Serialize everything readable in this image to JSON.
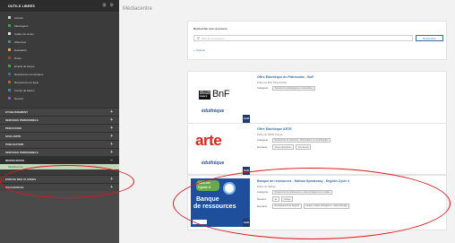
{
  "sidebar": {
    "title": "OUTILS LIBRES",
    "tools": [
      {
        "label": "Accueil",
        "color": "#cfcfcf"
      },
      {
        "label": "Messagerie",
        "color": "#3fa34d"
      },
      {
        "label": "Cahier de textes",
        "color": "#e8e8e8"
      },
      {
        "label": "Absences",
        "color": "#4a7fd0"
      },
      {
        "label": "Evaluation",
        "color": "#e8a43a"
      },
      {
        "label": "Notes",
        "color": "#c0392b"
      },
      {
        "label": "Emploi du temps",
        "color": "#3fa34d"
      },
      {
        "label": "Ressources numériques",
        "color": "#2f6fc0"
      },
      {
        "label": "Ressources en ligne",
        "color": "#d05a2a"
      },
      {
        "label": "Carnet de liaison",
        "color": "#4a7fd0"
      },
      {
        "label": "Devoirs",
        "color": "#8a5ac0"
      }
    ],
    "sections": [
      "ETABLISSEMENT",
      "SERVICES PERSONNELS",
      "PEDAGOGIE",
      "SCOLARITE",
      "PUBLICATION",
      "SERVICES PERSONNELS"
    ],
    "open_section": "RESSOURCES",
    "sub_item": "Médiacentre",
    "after_sections": [
      "ESPACE DES CLASSES",
      "RACCOURCIS"
    ]
  },
  "main": {
    "title": "Médiacentre",
    "search": {
      "label": "Rechercher une ressource",
      "placeholder": "Nom de la ressource",
      "button": "Rechercher",
      "options": "+ Options"
    },
    "cards": [
      {
        "title": "Offre Éduthèque du Patrimoine - BnF",
        "by": "Édité par BnF Partenariats",
        "category_label": "Catégorie",
        "categories": [
          "Ressources pédagogiques et éducatives"
        ],
        "logo_text": "BnF",
        "logo_box": "BIBLIOTHÈQUE NATIONALE DE FRANCE",
        "edu": "éduthèque",
        "gar": "GAR"
      },
      {
        "title": "Offre Éduthèque ARTE",
        "by": "Édité par ARTE France",
        "category_label": "Catégorie",
        "categories": [
          "Ressources de référence, dictionnaires et encyclopédies"
        ],
        "domain_label": "Domaine",
        "domains": [
          "Toutes disciplines",
          "Arts visuels"
        ],
        "logo_text": "arte",
        "edu": "éduthèque",
        "gar": "GAR"
      },
      {
        "title": "Banque de ressources - Nathan Speakeasy - English Cycle 4",
        "by": "Édité par Nathan",
        "category_label": "Catégorie",
        "categories": [
          "Ressources d'entraînement et d'accompagnement scolaire"
        ],
        "level_label": "Niveaux",
        "levels": [
          "4e",
          "Collège"
        ],
        "domain_label": "Domaine",
        "domains": [
          "Enseignement de langues",
          "Langue vivante étrangère 1 : Apprentissage"
        ],
        "logo_b1": "ANGLAIS",
        "logo_b2": "Cycle 4",
        "logo_q1": "Banque",
        "logo_q2": "de ressources",
        "gar": "GAR"
      }
    ]
  }
}
